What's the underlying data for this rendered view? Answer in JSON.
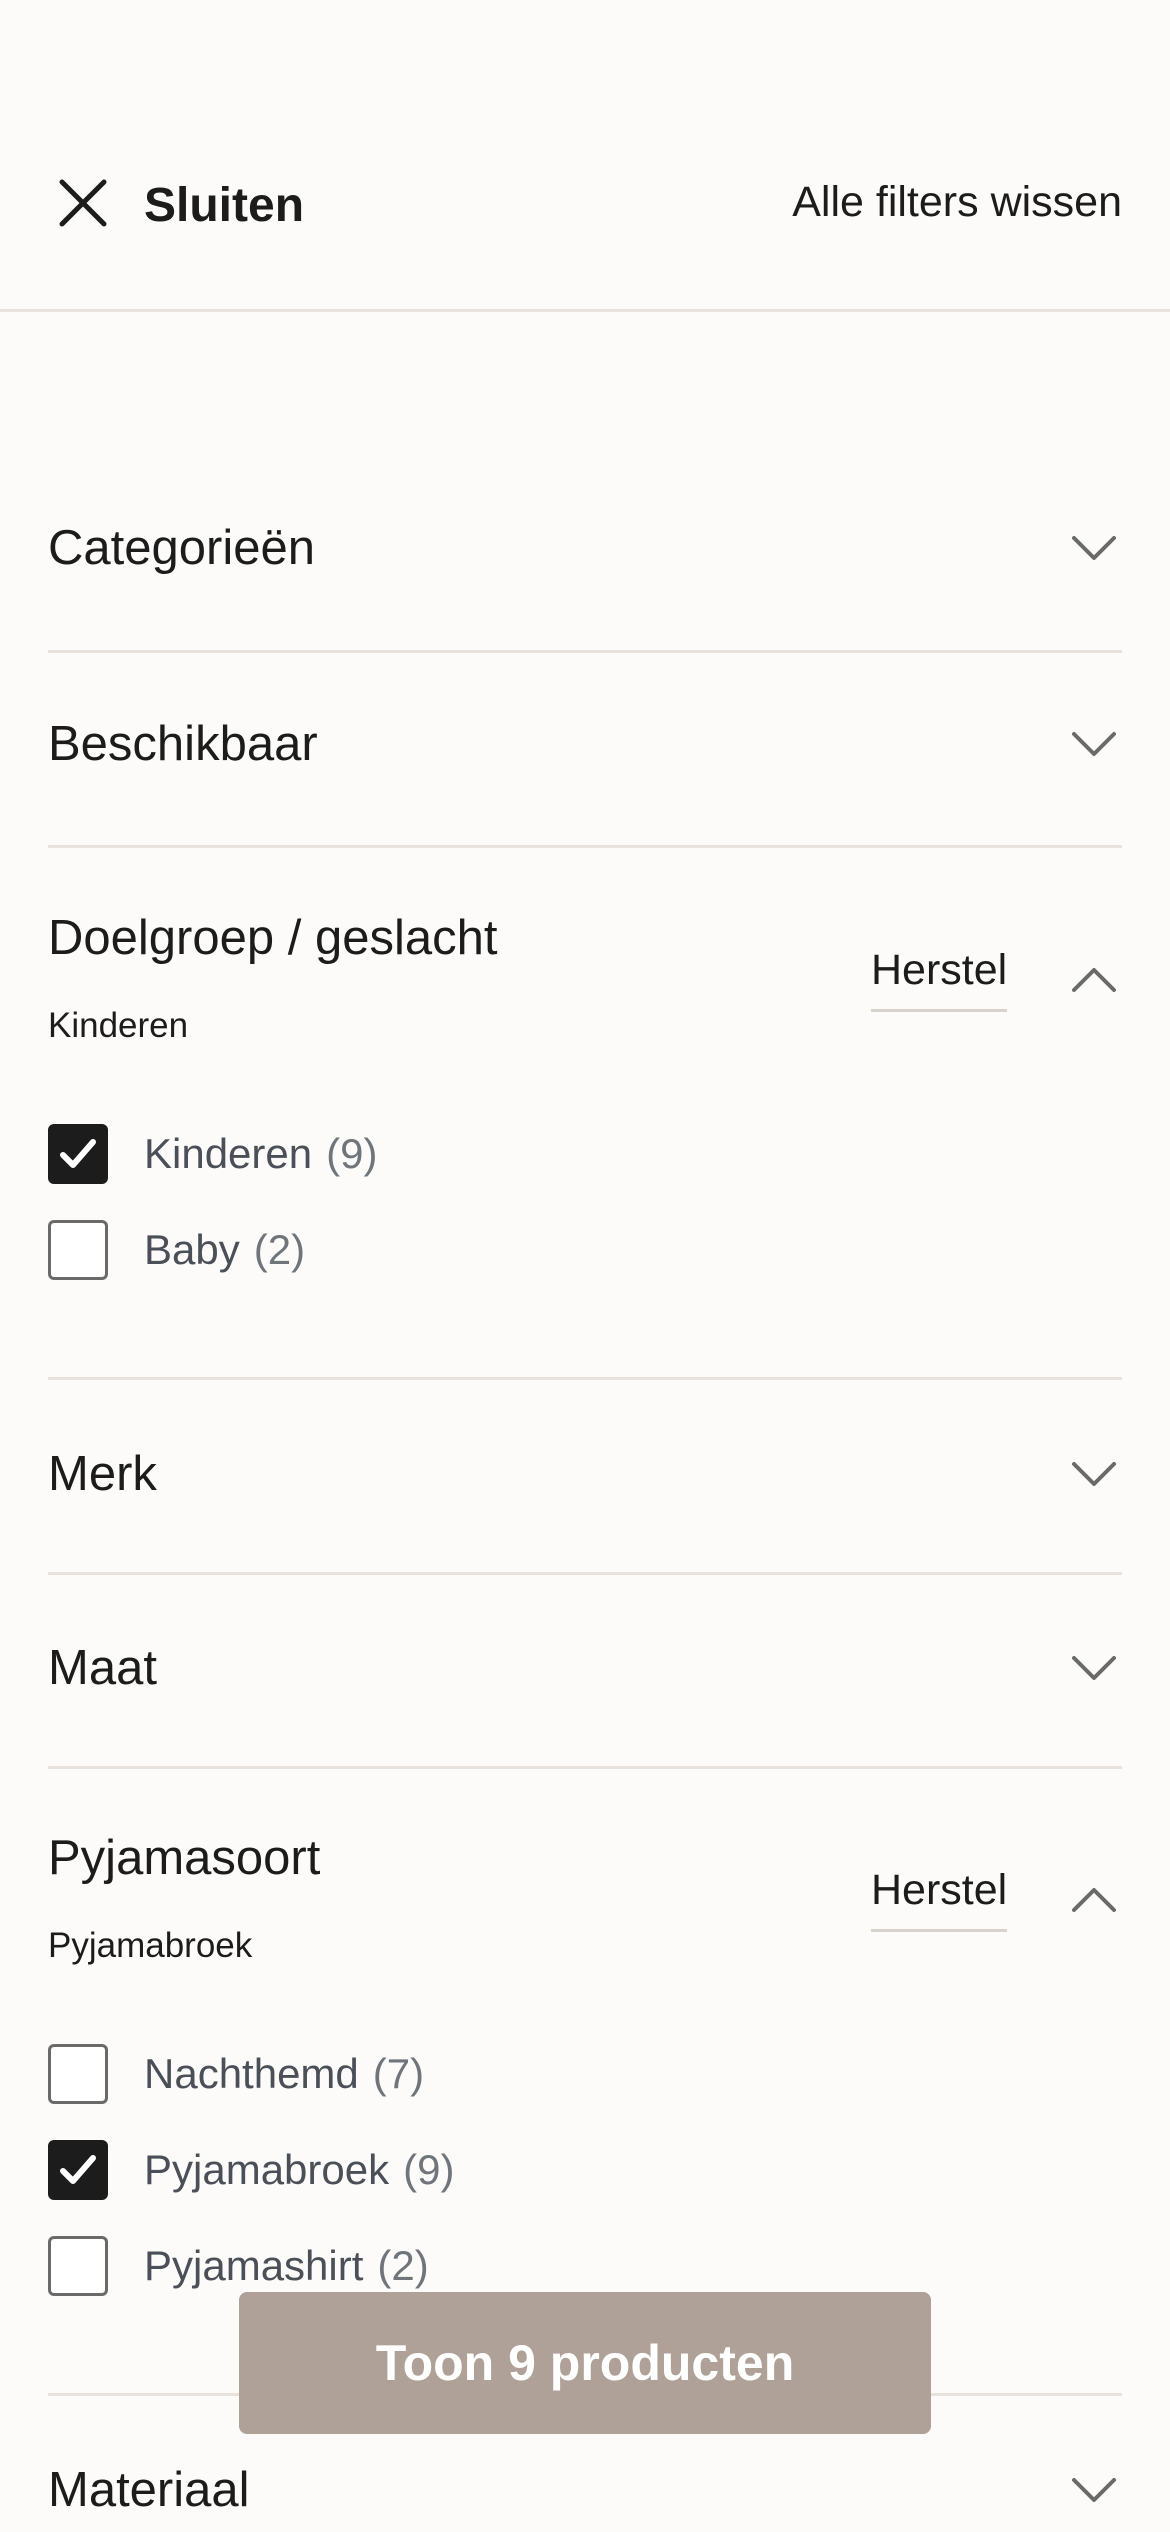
{
  "header": {
    "close_label": "Sluiten",
    "clear_all_label": "Alle filters wissen"
  },
  "sections": [
    {
      "title": "Categorieën",
      "expanded": false
    },
    {
      "title": "Beschikbaar",
      "expanded": false
    },
    {
      "title": "Doelgroep / geslacht",
      "expanded": true,
      "selected_summary": "Kinderen",
      "reset_label": "Herstel",
      "options": [
        {
          "label": "Kinderen",
          "count": "(9)",
          "checked": true
        },
        {
          "label": "Baby",
          "count": "(2)",
          "checked": false
        }
      ]
    },
    {
      "title": "Merk",
      "expanded": false
    },
    {
      "title": "Maat",
      "expanded": false
    },
    {
      "title": "Pyjamasoort",
      "expanded": true,
      "selected_summary": "Pyjamabroek",
      "reset_label": "Herstel",
      "options": [
        {
          "label": "Nachthemd",
          "count": "(7)",
          "checked": false
        },
        {
          "label": "Pyjamabroek",
          "count": "(9)",
          "checked": true
        },
        {
          "label": "Pyjamashirt",
          "count": "(2)",
          "checked": false
        }
      ]
    },
    {
      "title": "Materiaal",
      "expanded": false
    }
  ],
  "cta": {
    "label": "Toon 9 producten"
  },
  "colors": {
    "background": "#fcfbf9",
    "divider": "#e8e1dc",
    "cta_background": "#afa197",
    "checkbox_checked": "#1c1c1c",
    "option_text": "#4a4f58"
  },
  "icons": {
    "close": "close-icon",
    "collapsed": "chevron-down-icon",
    "expanded": "chevron-up-icon",
    "checked": "check-icon"
  }
}
